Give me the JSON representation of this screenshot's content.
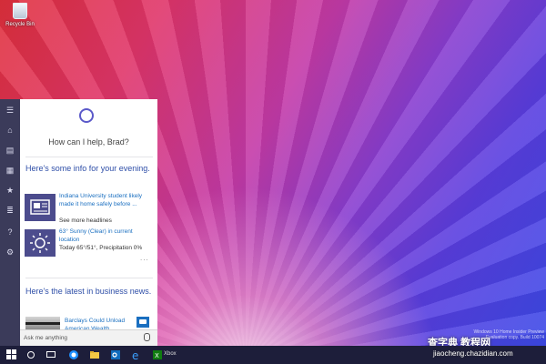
{
  "desktop": {
    "recycle_bin_label": "Recycle Bin"
  },
  "cortana": {
    "greeting": "How can I help, Brad?",
    "info_title": "Here's some info for your evening.",
    "news_card": {
      "headline": "Indiana University student likely made it home safely before ...",
      "see_more": "See more headlines",
      "icon": "newspaper-icon"
    },
    "weather_card": {
      "current": "63° Sunny (Clear) in current location",
      "forecast": "Today 65°/51°, Precipitation 0%",
      "icon": "sun-icon"
    },
    "more_dots": "...",
    "business_title": "Here's the latest in business news.",
    "business_headline": "Barclays Could Unload American Wealth",
    "ask_placeholder": "Ask me anything",
    "accent_color": "#4c4c8d"
  },
  "rail_icons": [
    "hamburger-icon",
    "home-icon",
    "notebook-icon",
    "calendar-icon",
    "star-icon",
    "list-icon",
    "help-icon",
    "settings-icon"
  ],
  "taskbar": {
    "xbox_label": "Xbox",
    "apps": [
      "start-icon",
      "search-icon",
      "task-view-icon",
      "ie-icon",
      "file-explorer-icon",
      "outlook-icon",
      "edge-icon",
      "xbox-icon"
    ]
  },
  "watermark": {
    "build_text": "Windows 10 Home Insider Preview Evaluation copy. Build 10074",
    "site_name": "查字典 教程网",
    "site_url": "jiaocheng.chazidian.com"
  }
}
